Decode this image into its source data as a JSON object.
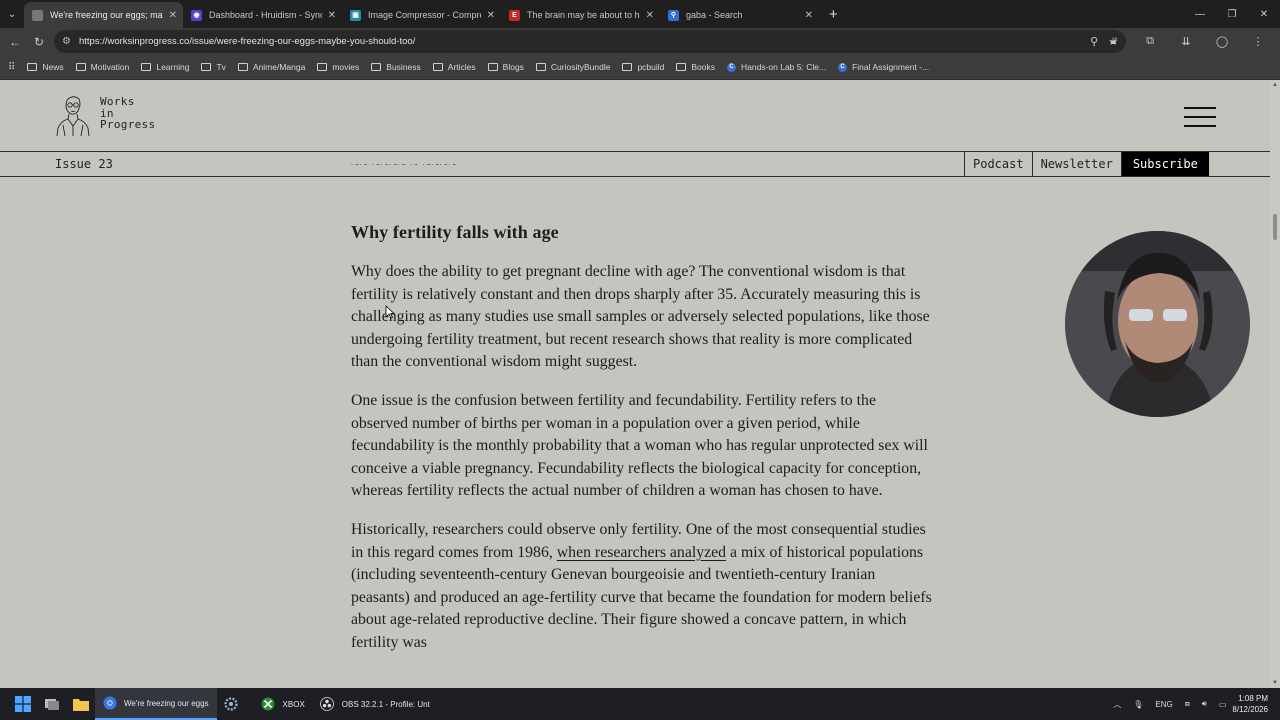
{
  "browser": {
    "tabs": [
      {
        "title": "We're freezing our eggs; maybe",
        "fav_color": "#777777",
        "fav_glyph": "",
        "active": true
      },
      {
        "title": "Dashboard - Hruidism - Synche",
        "fav_color": "#5a3fd1",
        "fav_glyph": "◉",
        "active": false
      },
      {
        "title": "Image Compressor - Compress",
        "fav_color": "#1e8fa6",
        "fav_glyph": "▣",
        "active": false
      },
      {
        "title": "The brain may be about to hav",
        "fav_color": "#c62828",
        "fav_glyph": "E",
        "active": false
      },
      {
        "title": "gaba - Search",
        "fav_color": "#2f6fd8",
        "fav_glyph": "⚲",
        "active": false
      }
    ],
    "url": "https://worksinprogress.co/issue/were-freezing-our-eggs-maybe-you-should-too/",
    "bookmarks": [
      {
        "label": "News",
        "kind": "folder"
      },
      {
        "label": "Motivation",
        "kind": "folder"
      },
      {
        "label": "Learning",
        "kind": "folder"
      },
      {
        "label": "Tv",
        "kind": "folder"
      },
      {
        "label": "Anime/Manga",
        "kind": "folder"
      },
      {
        "label": "movies",
        "kind": "folder"
      },
      {
        "label": "Business",
        "kind": "folder"
      },
      {
        "label": "Articles",
        "kind": "folder"
      },
      {
        "label": "Blogs",
        "kind": "folder"
      },
      {
        "label": "CuriosityBundle",
        "kind": "folder"
      },
      {
        "label": "pcbuild",
        "kind": "folder"
      },
      {
        "label": "Books",
        "kind": "folder"
      },
      {
        "label": "Hands-on Lab 5: Cle...",
        "kind": "link"
      },
      {
        "label": "Final Assignment -...",
        "kind": "link"
      }
    ]
  },
  "site": {
    "logo_lines": [
      "Works",
      "in",
      "Progress"
    ],
    "issue": "Issue 23",
    "nav": {
      "podcast": "Podcast",
      "newsletter": "Newsletter",
      "subscribe": "Subscribe"
    }
  },
  "article": {
    "heading": "Why fertility falls with age",
    "p1": "Why does the ability to get pregnant decline with age? The conventional wisdom is that fertility is relatively constant and then drops sharply after 35. Accurately measuring this is challenging as many studies use small samples or adversely selected populations, like those undergoing fertility treatment, but recent research shows that reality is more complicated than the conventional wisdom might suggest.",
    "p2": "One issue is the confusion between fertility and fecundability. Fertility refers to the observed number of births per woman in a population over a given period, while fecundability is the monthly probability that a woman who has regular unprotected sex will conceive a viable pregnancy. Fecundability reflects the biological capacity for conception, whereas fertility reflects the actual number of children a woman has chosen to have.",
    "p3_before": "Historically, researchers could observe only fertility. One of the most consequential studies in this regard comes from 1986, ",
    "p3_link": "when researchers analyzed",
    "p3_after": " a mix of historical populations (including seventeenth-century Genevan bourgeoisie and twentieth-century Iranian peasants) and produced an age-fertility curve that became the foundation for modern beliefs about age-related reproductive decline. Their figure showed a concave pattern, in which fertility was"
  },
  "taskbar": {
    "apps": [
      {
        "label": "We're freezing our eggs",
        "icon": "chrome-icon",
        "active": true
      },
      {
        "label": "",
        "icon": "settings-icon",
        "active": false
      },
      {
        "label": "XBOX",
        "icon": "xbox-icon",
        "active": false
      },
      {
        "label": "OBS 32.2.1 - Profile: Unt",
        "icon": "obs-icon",
        "active": false
      }
    ],
    "lang": "ENG",
    "time": "1:08 PM",
    "date": "8/12/2026"
  }
}
